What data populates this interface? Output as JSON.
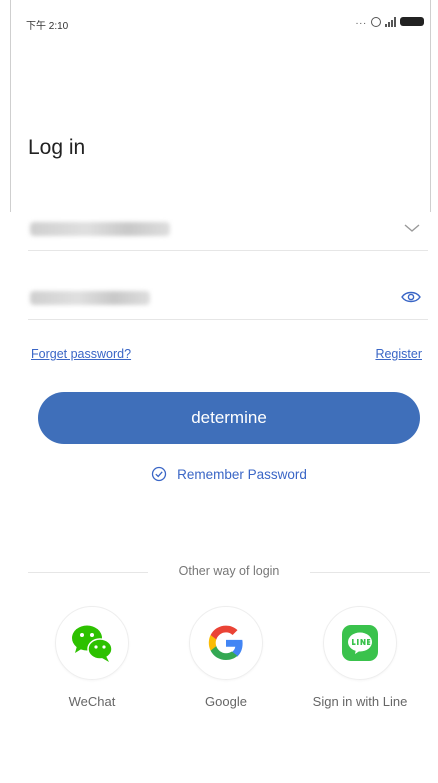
{
  "status_bar": {
    "time": "下午 2:10",
    "extra": "..."
  },
  "title": "Log in",
  "account_field": {
    "value": "•••••••••••••"
  },
  "password_field": {
    "value": "••••••••••"
  },
  "links": {
    "forget": "Forget password?",
    "register": "Register"
  },
  "primary_button": "determine",
  "remember": "Remember Password",
  "divider": "Other way of login",
  "social": [
    {
      "label": "WeChat",
      "icon": "wechat-icon"
    },
    {
      "label": "Google",
      "icon": "google-icon"
    },
    {
      "label": "Sign in with Line",
      "icon": "line-icon"
    }
  ],
  "colors": {
    "accent": "#3f6fba",
    "link": "#3a66c6",
    "wechat": "#2dc100",
    "line": "#3ac24c"
  }
}
